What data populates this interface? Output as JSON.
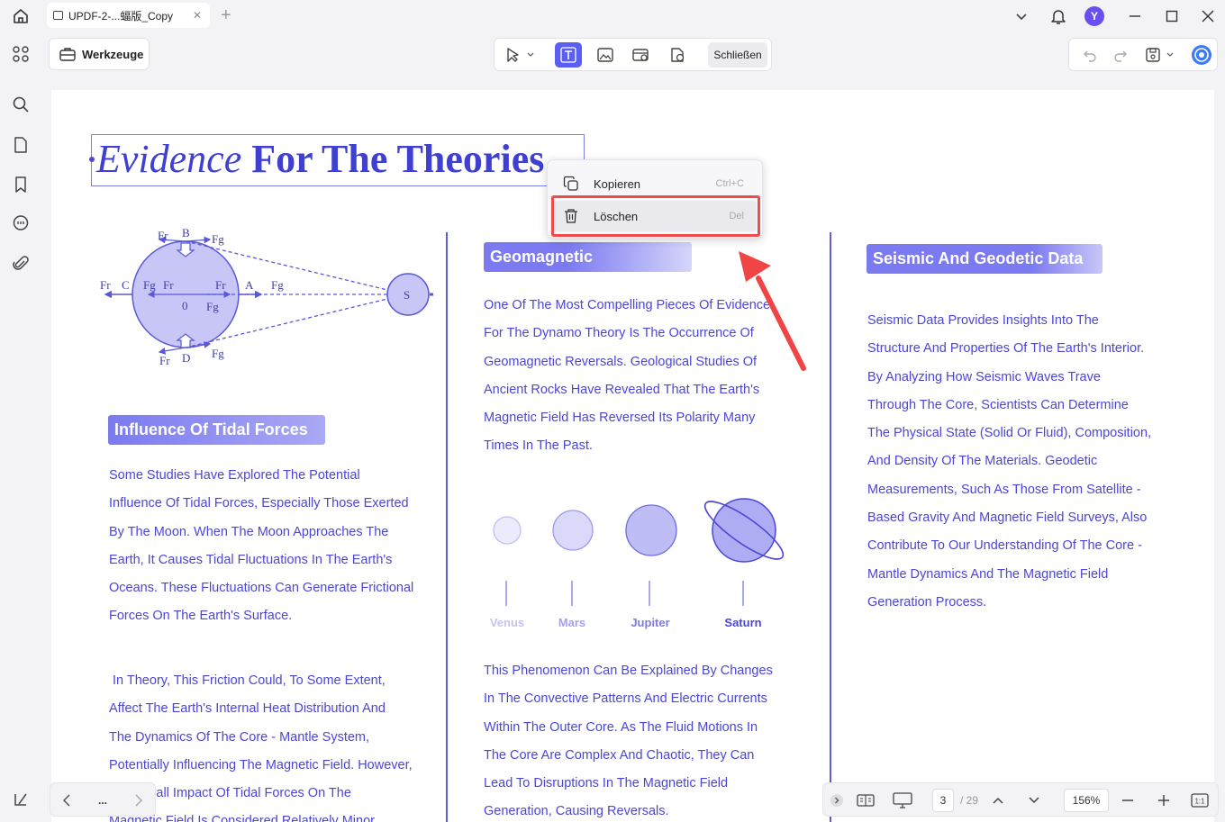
{
  "titlebar": {
    "tab_title": "UPDF-2-...蝠版_Copy",
    "tab_close": "✕",
    "add_tab": "+",
    "avatar_initial": "Y"
  },
  "toolbar": {
    "tools_label": "Werkzeuge",
    "close_label": "Schließen"
  },
  "document": {
    "title_italic": "Evidence",
    "title_bold": "For The Theories",
    "diagram_labels": [
      "Fr",
      "B",
      "Fg",
      "Fr",
      "C",
      "Fg",
      "Fr",
      "Fr",
      "A",
      "Fg",
      "0",
      "Fg",
      "S",
      "Fr",
      "D",
      "Fg"
    ],
    "left_column": {
      "heading": "Influence Of Tidal Forces",
      "para1": [
        "Some Studies Have Explored The Potential",
        "Influence Of Tidal Forces, Especially Those Exerted",
        "By The Moon. When The Moon Approaches The",
        "Earth, It Causes Tidal Fluctuations In The Earth's",
        "Oceans. These Fluctuations Can Generate Frictional",
        "Forces On The Earth's Surface."
      ],
      "para2": [
        " In Theory, This Friction Could, To Some Extent,",
        "Affect The Earth's Internal Heat Distribution And",
        "The Dynamics Of The Core - Mantle System,",
        "Potentially Influencing The Magnetic Field. However,",
        "the overall Impact Of Tidal Forces On The",
        "Magnetic Field Is Considered Relatively Minor"
      ]
    },
    "middle_column": {
      "heading": "Geomagnetic",
      "para1": [
        "One Of The Most Compelling Pieces Of Evidence",
        "For The Dynamo Theory Is The Occurrence Of",
        "Geomagnetic Reversals. Geological Studies Of",
        "Ancient Rocks Have Revealed That The Earth's",
        "Magnetic Field Has Reversed Its Polarity Many",
        "Times In The Past."
      ],
      "planets": [
        "Venus",
        "Mars",
        "Jupiter",
        "Saturn"
      ],
      "para2": [
        "This Phenomenon Can Be Explained By Changes",
        "In The Convective Patterns And Electric Currents",
        "Within The Outer Core. As The Fluid Motions In",
        "The Core Are Complex And Chaotic, They Can",
        "Lead To Disruptions In The Magnetic Field",
        "Generation, Causing Reversals."
      ]
    },
    "right_column": {
      "heading": "Seismic And Geodetic Data",
      "para1": [
        "Seismic Data Provides Insights Into The",
        "Structure And Properties Of The Earth's Interior.",
        "By Analyzing How Seismic Waves Trave",
        "Through The Core, Scientists Can Determine",
        "The Physical State (Solid Or Fluid), Composition,",
        "And Density Of The Materials. Geodetic",
        "Measurements, Such As Those From Satellite -",
        "Based Gravity And Magnetic Field Surveys, Also",
        "Contribute To Our Understanding Of The Core -",
        "Mantle Dynamics And The Magnetic Field",
        "Generation Process."
      ]
    }
  },
  "context_menu": {
    "items": [
      {
        "label": "Kopieren",
        "shortcut": "Ctrl+C"
      },
      {
        "label": "Löschen",
        "shortcut": "Del"
      }
    ]
  },
  "bottom_bar": {
    "current_page": "3",
    "total_pages": "/ 29",
    "zoom": "156%",
    "nav_more": "..."
  },
  "colors": {
    "accent": "#5b5ef2",
    "doc_text": "#4b46d8",
    "highlight_box": "#ef4b4b"
  }
}
